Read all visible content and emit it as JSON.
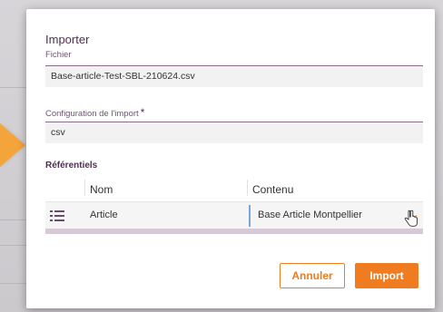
{
  "dialog": {
    "title": "Importer",
    "file_label": "Fichier",
    "file_value": "Base-article-Test-SBL-210624.csv",
    "config_label": "Configuration de l'import",
    "config_required": "*",
    "config_value": "csv",
    "referentials_label": "Référentiels",
    "table": {
      "columns": [
        "Nom",
        "Contenu"
      ],
      "rows": [
        {
          "nom": "Article",
          "contenu": "Base Article Montpellier"
        }
      ]
    },
    "buttons": {
      "cancel": "Annuler",
      "import": "Import"
    }
  },
  "icons": {
    "list": "list-icon",
    "dropdown": "chevron-down-icon",
    "cursor": "hand-pointer-icon"
  },
  "colors": {
    "accent": "#f07c21",
    "title": "#4d2f4f",
    "field_bg": "#f3f2f3",
    "divider_blue": "#7aa6d8"
  }
}
